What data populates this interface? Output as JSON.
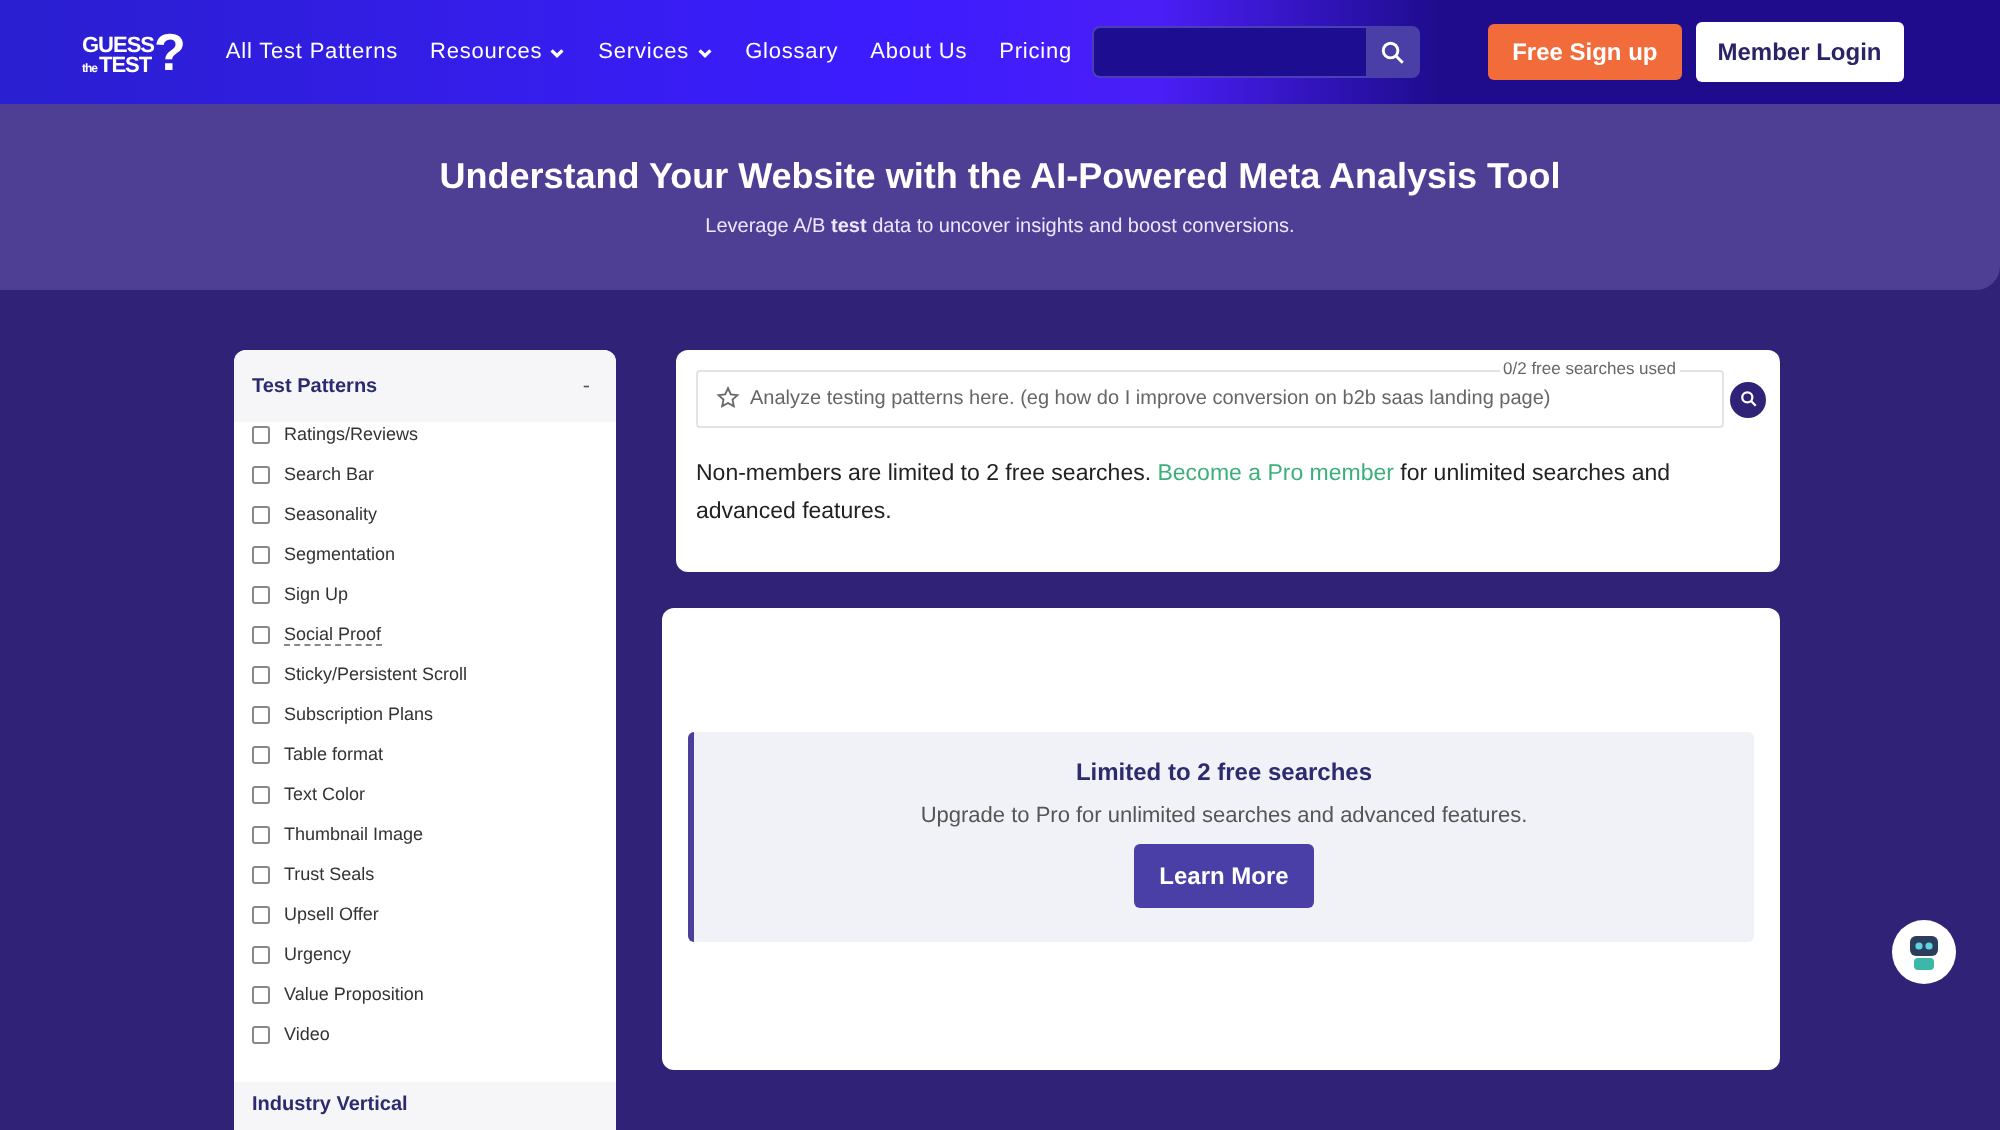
{
  "logo": {
    "top": "GUESS",
    "small": "the",
    "bottom": "TEST",
    "mark": "?"
  },
  "nav": [
    {
      "label": "All Test Patterns",
      "dropdown": false
    },
    {
      "label": "Resources",
      "dropdown": true
    },
    {
      "label": "Services",
      "dropdown": true
    },
    {
      "label": "Glossary",
      "dropdown": false
    },
    {
      "label": "About Us",
      "dropdown": false
    },
    {
      "label": "Pricing",
      "dropdown": false
    }
  ],
  "header_buttons": {
    "signup": "Free Sign up",
    "login": "Member Login"
  },
  "hero": {
    "title": "Understand Your Website with the AI-Powered Meta Analysis Tool",
    "subtitle": "Leverage A/B **test** data to uncover insights and boost conversions."
  },
  "sidebar": {
    "sections": [
      {
        "title": "Test Patterns",
        "toggle": "-",
        "items": [
          {
            "label": "Ratings/Reviews",
            "checked": false,
            "tooltip": false
          },
          {
            "label": "Search Bar",
            "checked": false,
            "tooltip": false
          },
          {
            "label": "Seasonality",
            "checked": false,
            "tooltip": false
          },
          {
            "label": "Segmentation",
            "checked": false,
            "tooltip": false
          },
          {
            "label": "Sign Up",
            "checked": false,
            "tooltip": false
          },
          {
            "label": "Social Proof",
            "checked": false,
            "tooltip": true
          },
          {
            "label": "Sticky/Persistent Scroll",
            "checked": false,
            "tooltip": false
          },
          {
            "label": "Subscription Plans",
            "checked": false,
            "tooltip": false
          },
          {
            "label": "Table format",
            "checked": false,
            "tooltip": false
          },
          {
            "label": "Text Color",
            "checked": false,
            "tooltip": false
          },
          {
            "label": "Thumbnail Image",
            "checked": false,
            "tooltip": false
          },
          {
            "label": "Trust Seals",
            "checked": false,
            "tooltip": false
          },
          {
            "label": "Upsell Offer",
            "checked": false,
            "tooltip": false
          },
          {
            "label": "Urgency",
            "checked": false,
            "tooltip": false
          },
          {
            "label": "Value Proposition",
            "checked": false,
            "tooltip": false
          },
          {
            "label": "Video",
            "checked": false,
            "tooltip": false
          }
        ]
      },
      {
        "title": "Industry Vertical"
      }
    ]
  },
  "search": {
    "placeholder": "Analyze testing patterns here. (eg how do I improve conversion on b2b saas landing page)",
    "counter": "0/2 free searches used"
  },
  "notice": {
    "before": "Non-members are limited to 2 free searches. ",
    "link": "Become a Pro member",
    "after": " for unlimited searches and advanced features."
  },
  "upgrade": {
    "title": "Limited to 2 free searches",
    "text": "Upgrade to Pro for unlimited searches and advanced features.",
    "button": "Learn More"
  }
}
